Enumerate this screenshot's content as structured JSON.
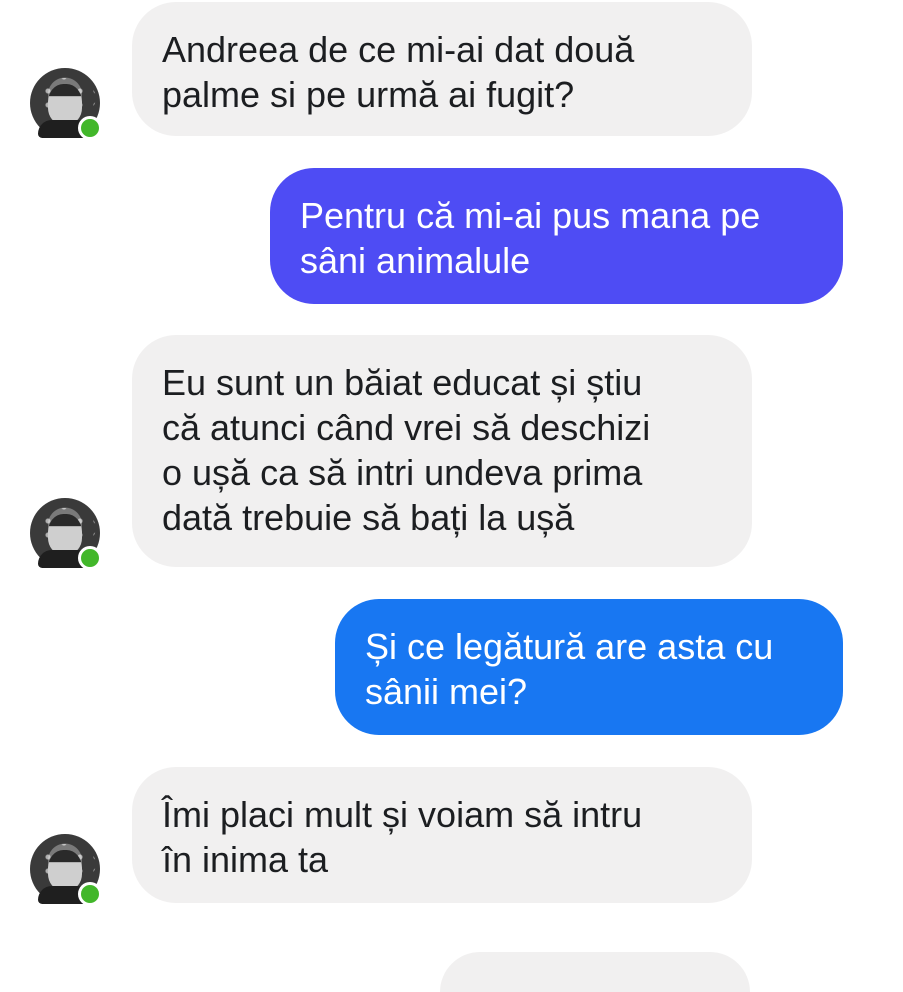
{
  "conversation": {
    "messages": [
      {
        "sender": "contact",
        "text": "Andreea de ce mi-ai dat două\npalme si pe urmă ai fugit?",
        "status": "online"
      },
      {
        "sender": "me",
        "text": "Pentru că mi-ai pus mana pe\nsâni animalule",
        "bubble_color": "#4e4cf4"
      },
      {
        "sender": "contact",
        "text": "Eu sunt un băiat educat și știu\ncă atunci când vrei să deschizi\no ușă ca să intri undeva prima\ndată trebuie să bați la ușă",
        "status": "online"
      },
      {
        "sender": "me",
        "text": "Și ce legătură are asta cu\nsânii mei?",
        "bubble_color": "#1877f2"
      },
      {
        "sender": "contact",
        "text": "Îmi placi mult și voiam să intru\nîn inima ta",
        "status": "online"
      }
    ]
  },
  "colors": {
    "incoming_bubble": "#f1f0f0",
    "online_indicator": "#42b72a"
  },
  "icons": {
    "avatar": "contact-avatar-photo",
    "presence": "online-dot-icon"
  }
}
